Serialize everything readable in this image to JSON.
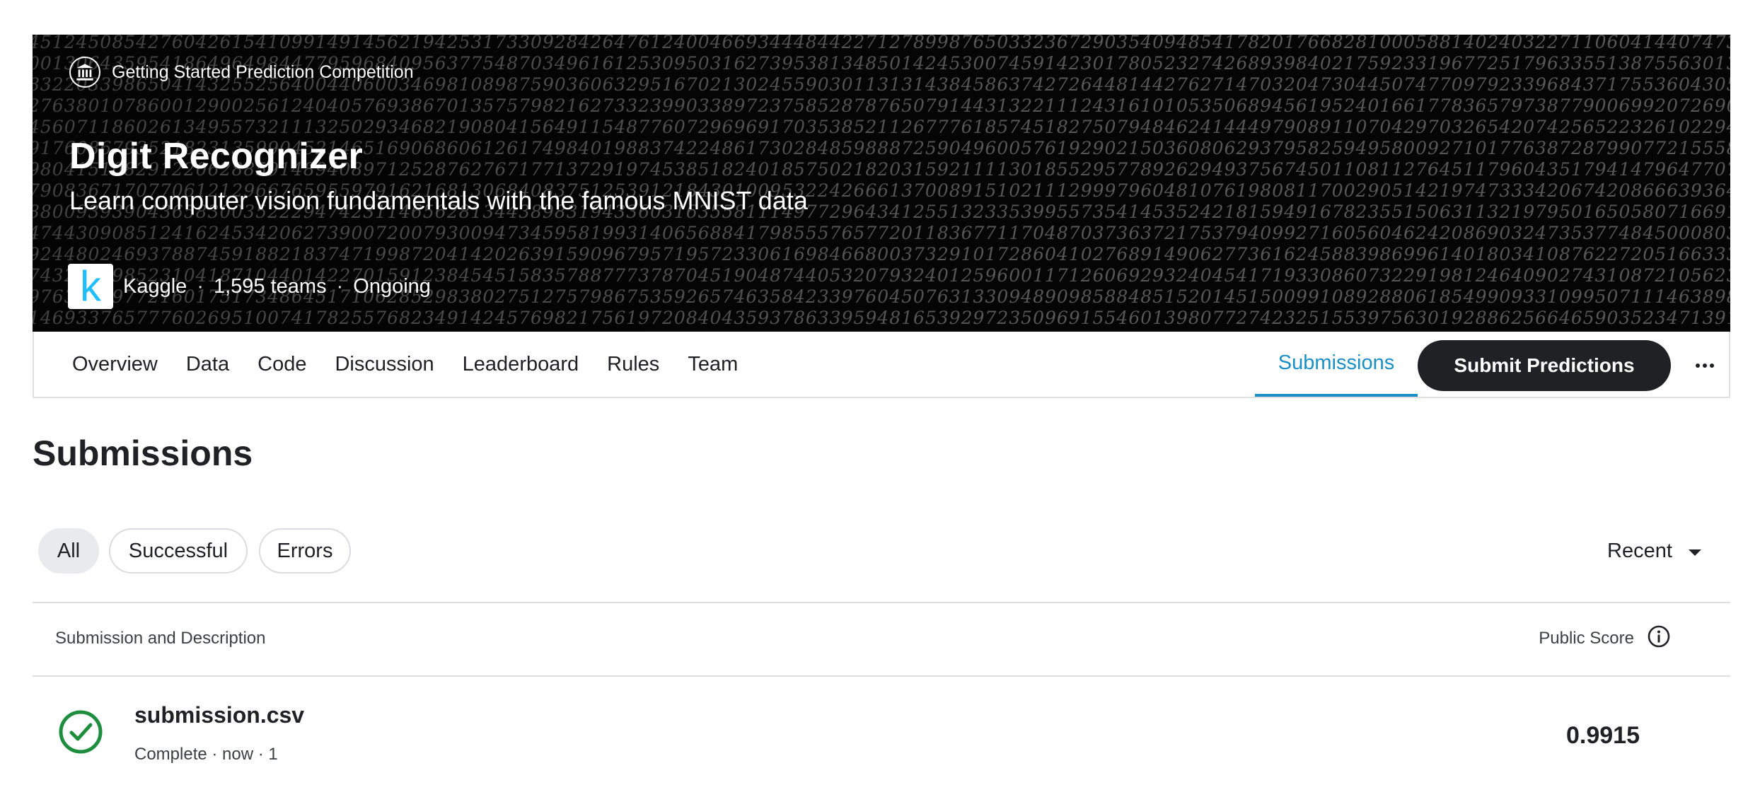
{
  "hero": {
    "category": "Getting Started Prediction Competition",
    "title": "Digit Recognizer",
    "subtitle": "Learn computer vision fundamentals with the famous MNIST data",
    "host": "Kaggle",
    "teams": "1,595 teams",
    "status": "Ongoing",
    "host_logo_letter": "k",
    "category_icon": "institution-icon"
  },
  "tabs": {
    "items": [
      "Overview",
      "Data",
      "Code",
      "Discussion",
      "Leaderboard",
      "Rules",
      "Team"
    ],
    "active": "Submissions",
    "submit_label": "Submit Predictions",
    "more_icon": "more-horizontal-icon"
  },
  "page": {
    "title": "Submissions"
  },
  "filters": {
    "chips": [
      "All",
      "Successful",
      "Errors"
    ],
    "selected": "All",
    "sort_label": "Recent"
  },
  "table": {
    "col_submission": "Submission and Description",
    "col_score": "Public Score",
    "rows": [
      {
        "file": "submission.csv",
        "meta": "Complete · now · 1",
        "score": "0.9915",
        "status_icon": "check-circle-icon"
      }
    ]
  },
  "colors": {
    "accent": "#1a8fc6",
    "success": "#1e8e3e",
    "dark_button": "#202124",
    "kaggle_blue": "#20beff"
  }
}
